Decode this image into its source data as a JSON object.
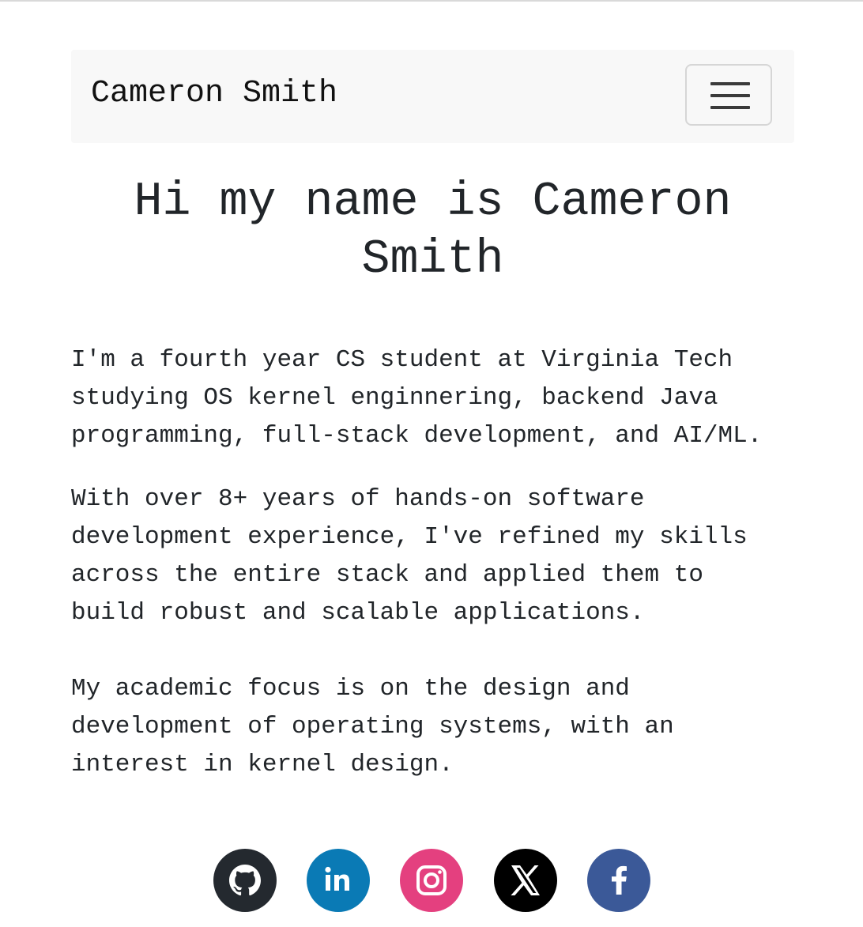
{
  "navbar": {
    "brand": "Cameron Smith",
    "toggler_icon": "hamburger-menu-icon"
  },
  "hero": {
    "title": "Hi my name is Cameron Smith"
  },
  "about": {
    "paragraph1": "I'm a fourth year CS student at Virginia Tech\nstudying OS kernel enginnering, backend Java\nprogramming, full-stack development, and AI/ML.",
    "paragraph2": "With over 8+ years of hands-on software\ndevelopment experience, I've refined my skills\nacross the entire stack and applied them to\nbuild robust and scalable applications.",
    "paragraph3": "My academic focus is on the design and\ndevelopment of operating systems, with an\ninterest in kernel design."
  },
  "socials": [
    {
      "icon": "github-icon",
      "color": "#24292f"
    },
    {
      "icon": "linkedin-icon",
      "color": "#0a7ab5"
    },
    {
      "icon": "instagram-icon",
      "color": "#e4407f"
    },
    {
      "icon": "x-twitter-icon",
      "color": "#000000"
    },
    {
      "icon": "facebook-icon",
      "color": "#3b5998"
    }
  ]
}
